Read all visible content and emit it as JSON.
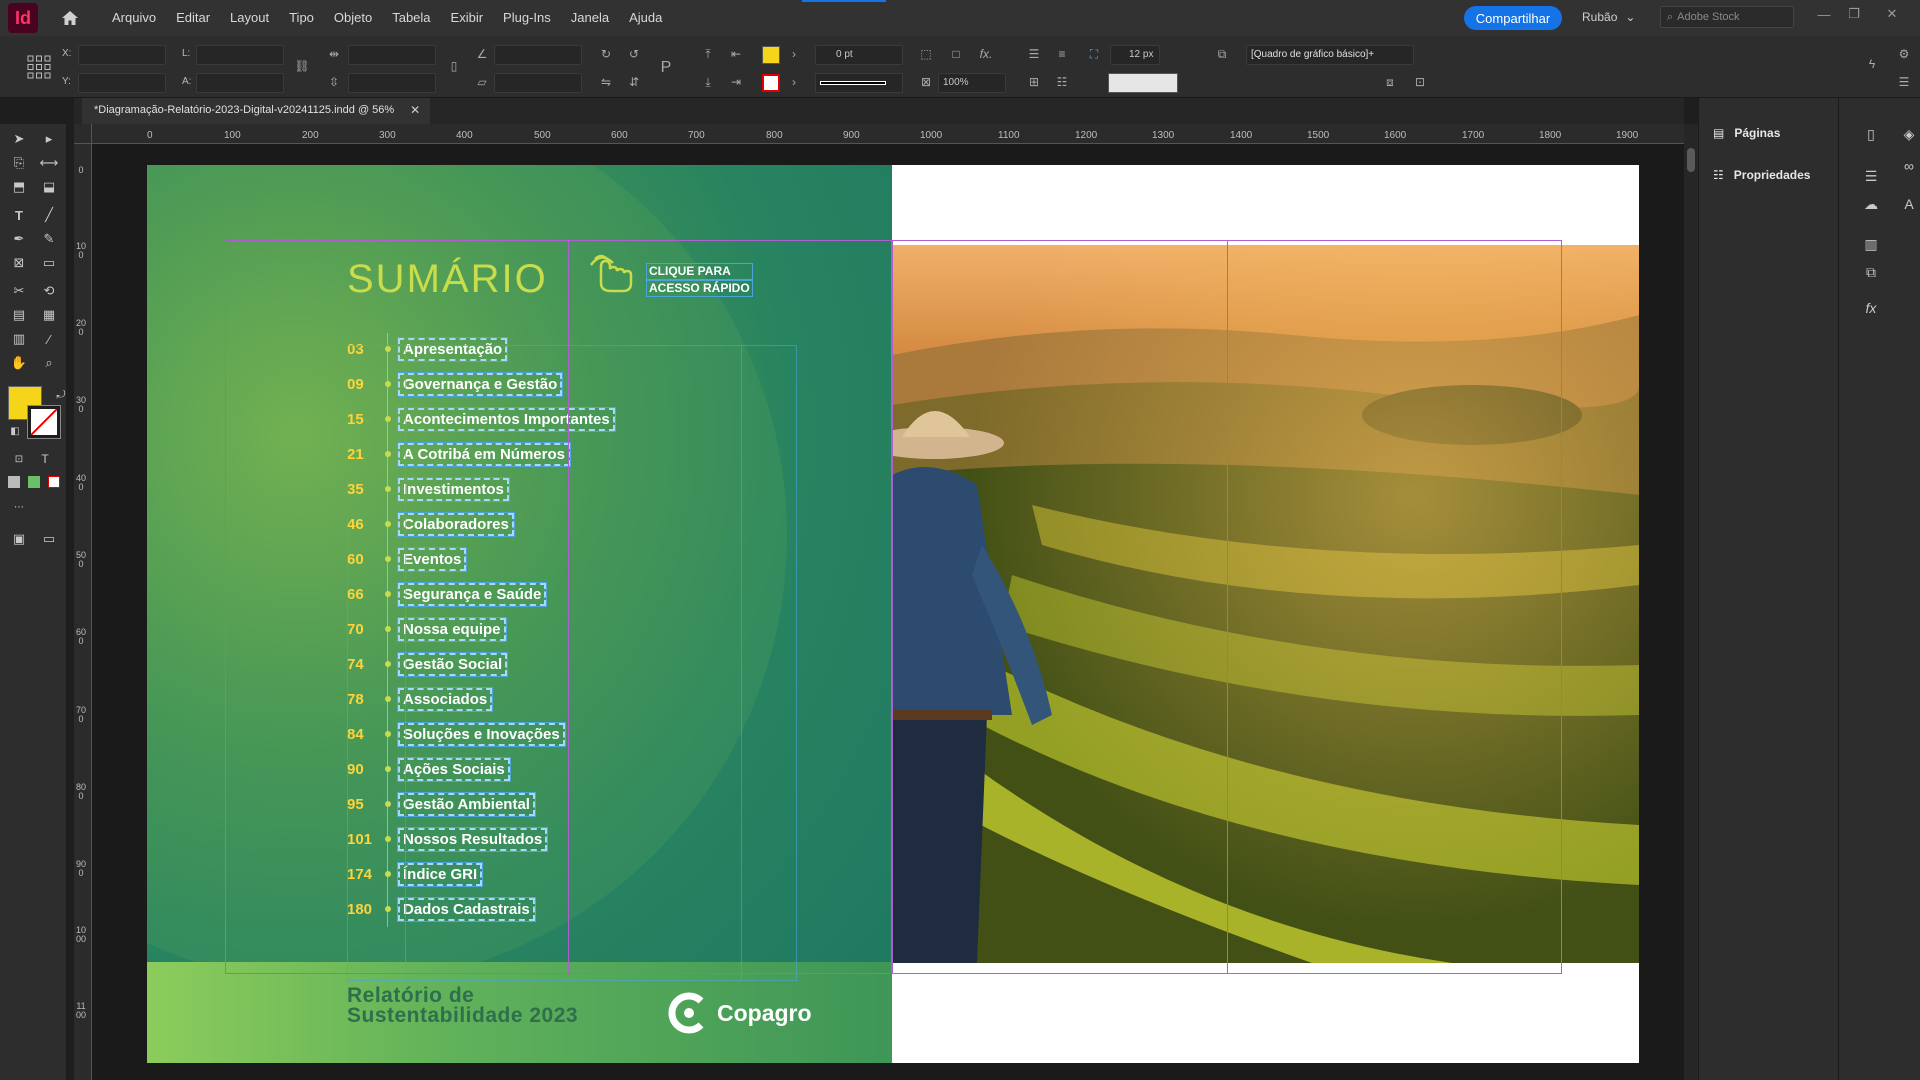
{
  "app": {
    "logo": "Id",
    "menus": [
      "Arquivo",
      "Editar",
      "Layout",
      "Tipo",
      "Objeto",
      "Tabela",
      "Exibir",
      "Plug-Ins",
      "Janela",
      "Ajuda"
    ],
    "share_label": "Compartilhar",
    "user_name": "Rubão",
    "stock_placeholder": "Adobe Stock"
  },
  "control": {
    "x_label": "X:",
    "y_label": "Y:",
    "w_label": "L:",
    "h_label": "A:",
    "stroke_weight": "0 pt",
    "opacity": "100%",
    "corner_size": "12 px",
    "object_style": "[Quadro de gráfico básico]+"
  },
  "document": {
    "tab_title": "*Diagramação-Relatório-2023-Digital-v20241125.indd @ 56%"
  },
  "rulers": {
    "horizontal": [
      "0",
      "100",
      "200",
      "300",
      "400",
      "500",
      "600",
      "700",
      "800",
      "900",
      "1000",
      "1100",
      "1200",
      "1300",
      "1400",
      "1500",
      "1600",
      "1700",
      "1800",
      "1900"
    ],
    "vertical": [
      "0",
      "100",
      "200",
      "300",
      "400",
      "500",
      "600",
      "700",
      "800",
      "900",
      "1000",
      "1100"
    ]
  },
  "page": {
    "title": "SUMÁRIO",
    "click_line1": "CLIQUE PARA",
    "click_line2": "ACESSO RÁPIDO",
    "toc": [
      {
        "num": "03",
        "label": "Apresentação"
      },
      {
        "num": "09",
        "label": "Governança e Gestão"
      },
      {
        "num": "15",
        "label": "Acontecimentos Importantes"
      },
      {
        "num": "21",
        "label": "A Cotribá em Números"
      },
      {
        "num": "35",
        "label": "Investimentos"
      },
      {
        "num": "46",
        "label": "Colaboradores"
      },
      {
        "num": "60",
        "label": "Eventos"
      },
      {
        "num": "66",
        "label": "Segurança e Saúde"
      },
      {
        "num": "70",
        "label": "Nossa equipe"
      },
      {
        "num": "74",
        "label": "Gestão Social"
      },
      {
        "num": "78",
        "label": "Associados"
      },
      {
        "num": "84",
        "label": "Soluções e Inovações"
      },
      {
        "num": "90",
        "label": "Ações Sociais"
      },
      {
        "num": "95",
        "label": "Gestão Ambiental"
      },
      {
        "num": "101",
        "label": "Nossos Resultados"
      },
      {
        "num": "174",
        "label": "Índice GRI"
      },
      {
        "num": "180",
        "label": "Dados Cadastrais"
      }
    ],
    "report_line1": "Relatório de",
    "report_line2": "Sustentabilidade 2023",
    "brand": "Copagro"
  },
  "panels": {
    "pages_label": "Páginas",
    "properties_label": "Propriedades"
  },
  "colors": {
    "accent": "#1473e6",
    "fill_swatch": "#f5d51a",
    "title_green": "#c8dc4c",
    "toc_number": "#ffd33a",
    "guide_purple": "#b05fd0",
    "frame_cyan": "#4aa5d8"
  }
}
